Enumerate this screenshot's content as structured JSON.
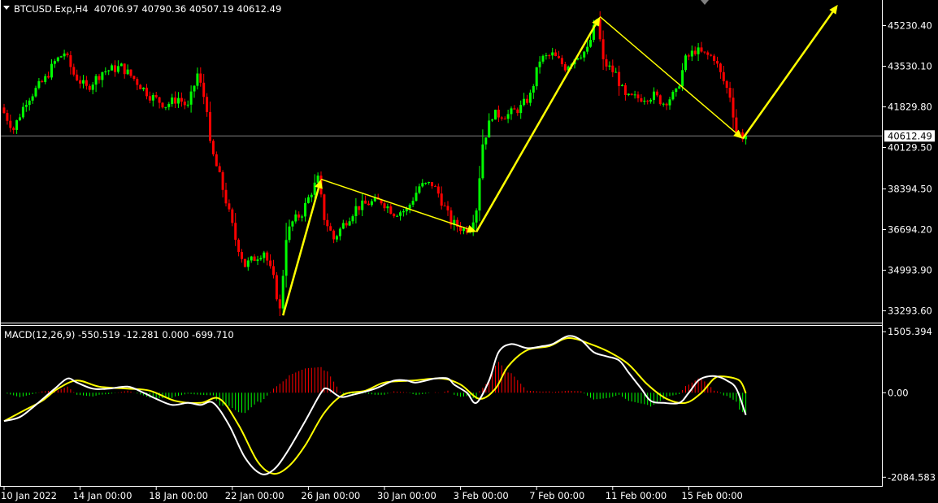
{
  "header": {
    "symbol_line": "BTCUSD.Exp,H4  40706.97 40790.36 40507.19 40612.49"
  },
  "macd_header": "MACD(12,26,9) -550.519 -12.281 0.000 -699.710",
  "colors": {
    "background": "#000000",
    "bull": "#00ff00",
    "bear": "#ff0000",
    "arrow": "#ffff00",
    "macd_line": "#ffffff",
    "signal_line": "#ffff00",
    "hist_pos": "#ff0000",
    "hist_neg": "#00ff00",
    "frame": "#ffffff",
    "price_line": "#808080"
  },
  "chart_data": [
    {
      "type": "candlestick",
      "title": "BTCUSD.Exp,H4",
      "timeframe": "H4",
      "last_ohlc": {
        "open": 40706.97,
        "high": 40790.36,
        "low": 40507.19,
        "close": 40612.49
      },
      "current_price_label": "40612.49",
      "current_price": 40612.49,
      "y_ticks": [
        "45230.40",
        "43530.10",
        "41829.80",
        "40129.50",
        "38394.50",
        "36694.20",
        "34993.90",
        "33293.60"
      ],
      "y_tick_values": [
        45230.4,
        43530.1,
        41829.8,
        40129.5,
        38394.5,
        36694.2,
        34993.9,
        33293.6
      ],
      "x_ticks": [
        "10 Jan 2022",
        "14 Jan 00:00",
        "18 Jan 00:00",
        "22 Jan 00:00",
        "26 Jan 00:00",
        "30 Jan 00:00",
        "3 Feb 00:00",
        "7 Feb 00:00",
        "11 Feb 00:00",
        "15 Feb 00:00"
      ],
      "x_start": "2022-01-10 00:00",
      "ylim": [
        32800,
        46300
      ],
      "price_path": [
        [
          "2022-01-10 00:00",
          41800
        ],
        [
          "2022-01-10 16:00",
          40900
        ],
        [
          "2022-01-11 08:00",
          42100
        ],
        [
          "2022-01-12 08:00",
          43000
        ],
        [
          "2022-01-12 20:00",
          43700
        ],
        [
          "2022-01-13 08:00",
          44100
        ],
        [
          "2022-01-13 20:00",
          43200
        ],
        [
          "2022-01-14 12:00",
          42600
        ],
        [
          "2022-01-15 08:00",
          43300
        ],
        [
          "2022-01-16 08:00",
          43500
        ],
        [
          "2022-01-17 00:00",
          43000
        ],
        [
          "2022-01-17 20:00",
          42300
        ],
        [
          "2022-01-18 16:00",
          41900
        ],
        [
          "2022-01-19 08:00",
          42200
        ],
        [
          "2022-01-19 20:00",
          41800
        ],
        [
          "2022-01-20 08:00",
          43200
        ],
        [
          "2022-01-20 20:00",
          41800
        ],
        [
          "2022-01-21 00:00",
          40200
        ],
        [
          "2022-01-21 12:00",
          38900
        ],
        [
          "2022-01-21 20:00",
          37900
        ],
        [
          "2022-01-22 08:00",
          36300
        ],
        [
          "2022-01-22 20:00",
          35200
        ],
        [
          "2022-01-23 08:00",
          35500
        ],
        [
          "2022-01-23 20:00",
          35800
        ],
        [
          "2022-01-24 08:00",
          34600
        ],
        [
          "2022-01-24 16:00",
          33300
        ],
        [
          "2022-01-25 00:00",
          36400
        ],
        [
          "2022-01-25 08:00",
          37000
        ],
        [
          "2022-01-25 20:00",
          37400
        ],
        [
          "2022-01-26 08:00",
          38300
        ],
        [
          "2022-01-26 16:00",
          38800
        ],
        [
          "2022-01-27 00:00",
          37200
        ],
        [
          "2022-01-27 12:00",
          36300
        ],
        [
          "2022-01-28 00:00",
          36900
        ],
        [
          "2022-01-28 16:00",
          37600
        ],
        [
          "2022-01-29 08:00",
          37800
        ],
        [
          "2022-01-30 00:00",
          37900
        ],
        [
          "2022-01-30 16:00",
          37400
        ],
        [
          "2022-01-31 08:00",
          37500
        ],
        [
          "2022-02-01 00:00",
          38500
        ],
        [
          "2022-02-01 16:00",
          38600
        ],
        [
          "2022-02-02 00:00",
          38200
        ],
        [
          "2022-02-02 16:00",
          37000
        ],
        [
          "2022-02-03 08:00",
          36700
        ],
        [
          "2022-02-03 16:00",
          36800
        ],
        [
          "2022-02-04 00:00",
          37600
        ],
        [
          "2022-02-04 08:00",
          40300
        ],
        [
          "2022-02-04 20:00",
          41500
        ],
        [
          "2022-02-05 16:00",
          41500
        ],
        [
          "2022-02-06 08:00",
          41800
        ],
        [
          "2022-02-06 20:00",
          42300
        ],
        [
          "2022-02-07 08:00",
          43800
        ],
        [
          "2022-02-08 00:00",
          44000
        ],
        [
          "2022-02-08 16:00",
          43500
        ],
        [
          "2022-02-09 08:00",
          44000
        ],
        [
          "2022-02-09 20:00",
          44200
        ],
        [
          "2022-02-10 08:00",
          45500
        ],
        [
          "2022-02-10 16:00",
          43700
        ],
        [
          "2022-02-11 08:00",
          43200
        ],
        [
          "2022-02-11 20:00",
          42200
        ],
        [
          "2022-02-12 12:00",
          42200
        ],
        [
          "2022-02-13 08:00",
          42300
        ],
        [
          "2022-02-13 20:00",
          42000
        ],
        [
          "2022-02-14 12:00",
          42400
        ],
        [
          "2022-02-15 00:00",
          43800
        ],
        [
          "2022-02-15 12:00",
          44200
        ],
        [
          "2022-02-16 00:00",
          44000
        ],
        [
          "2022-02-16 12:00",
          43900
        ],
        [
          "2022-02-16 20:00",
          43200
        ],
        [
          "2022-02-17 08:00",
          42300
        ],
        [
          "2022-02-17 16:00",
          40800
        ],
        [
          "2022-02-18 00:00",
          40612.49
        ]
      ],
      "annotations": {
        "arrows": [
          {
            "from": [
              "2022-01-24 16:00",
              33100
            ],
            "to": [
              "2022-01-26 16:00",
              38800
            ]
          },
          {
            "from": [
              "2022-01-26 16:00",
              38800
            ],
            "to": [
              "2022-02-03 20:00",
              36600
            ]
          },
          {
            "from": [
              "2022-02-03 20:00",
              36600
            ],
            "to": [
              "2022-02-10 08:00",
              45600
            ]
          },
          {
            "from": [
              "2022-02-10 08:00",
              45600
            ],
            "to": [
              "2022-02-17 20:00",
              40500
            ]
          },
          {
            "from": [
              "2022-02-17 20:00",
              40500
            ],
            "to": [
              "2022-02-22 20:00",
              46100
            ]
          }
        ]
      }
    },
    {
      "type": "line",
      "title": "MACD(12,26,9) -550.519 -12.281 0.000 -699.710",
      "y_ticks": [
        "1505.394",
        "0.00",
        "-2084.583"
      ],
      "y_tick_values": [
        1505.394,
        0,
        -2084.583
      ],
      "ylim": [
        -2300,
        1650
      ],
      "series": [
        {
          "name": "MACD",
          "points": [
            [
              "2022-01-10 00:00",
              -700
            ],
            [
              "2022-01-10 20:00",
              -600
            ],
            [
              "2022-01-11 16:00",
              -300
            ],
            [
              "2022-01-12 16:00",
              100
            ],
            [
              "2022-01-13 08:00",
              350
            ],
            [
              "2022-01-13 20:00",
              250
            ],
            [
              "2022-01-14 16:00",
              100
            ],
            [
              "2022-01-15 12:00",
              100
            ],
            [
              "2022-01-16 12:00",
              150
            ],
            [
              "2022-01-17 08:00",
              0
            ],
            [
              "2022-01-18 00:00",
              -150
            ],
            [
              "2022-01-18 20:00",
              -300
            ],
            [
              "2022-01-19 16:00",
              -250
            ],
            [
              "2022-01-20 08:00",
              -300
            ],
            [
              "2022-01-21 00:00",
              -250
            ],
            [
              "2022-01-21 20:00",
              -800
            ],
            [
              "2022-01-22 16:00",
              -1600
            ],
            [
              "2022-01-23 12:00",
              -2000
            ],
            [
              "2022-01-24 04:00",
              -1900
            ],
            [
              "2022-01-24 20:00",
              -1500
            ],
            [
              "2022-01-25 20:00",
              -700
            ],
            [
              "2022-01-26 16:00",
              0
            ],
            [
              "2022-01-27 00:00",
              100
            ],
            [
              "2022-01-27 16:00",
              -100
            ],
            [
              "2022-01-28 08:00",
              -50
            ],
            [
              "2022-01-29 12:00",
              100
            ],
            [
              "2022-01-30 12:00",
              300
            ],
            [
              "2022-01-31 04:00",
              300
            ],
            [
              "2022-01-31 16:00",
              250
            ],
            [
              "2022-02-01 16:00",
              350
            ],
            [
              "2022-02-02 08:00",
              350
            ],
            [
              "2022-02-02 16:00",
              200
            ],
            [
              "2022-02-03 08:00",
              0
            ],
            [
              "2022-02-03 20:00",
              -250
            ],
            [
              "2022-02-04 12:00",
              300
            ],
            [
              "2022-02-05 00:00",
              1000
            ],
            [
              "2022-02-05 16:00",
              1200
            ],
            [
              "2022-02-06 12:00",
              1100
            ],
            [
              "2022-02-07 08:00",
              1150
            ],
            [
              "2022-02-07 20:00",
              1200
            ],
            [
              "2022-02-08 16:00",
              1400
            ],
            [
              "2022-02-09 08:00",
              1300
            ],
            [
              "2022-02-10 00:00",
              1000
            ],
            [
              "2022-02-10 16:00",
              900
            ],
            [
              "2022-02-11 08:00",
              800
            ],
            [
              "2022-02-11 20:00",
              500
            ],
            [
              "2022-02-12 12:00",
              100
            ],
            [
              "2022-02-13 00:00",
              -200
            ],
            [
              "2022-02-13 16:00",
              -250
            ],
            [
              "2022-02-14 12:00",
              -250
            ],
            [
              "2022-02-15 00:00",
              0
            ],
            [
              "2022-02-15 12:00",
              300
            ],
            [
              "2022-02-16 00:00",
              400
            ],
            [
              "2022-02-16 12:00",
              400
            ],
            [
              "2022-02-17 00:00",
              300
            ],
            [
              "2022-02-17 12:00",
              100
            ],
            [
              "2022-02-18 00:00",
              -550.519
            ]
          ]
        },
        {
          "name": "Signal",
          "points": [
            [
              "2022-01-10 00:00",
              -700
            ],
            [
              "2022-01-11 00:00",
              -450
            ],
            [
              "2022-01-12 00:00",
              -200
            ],
            [
              "2022-01-12 20:00",
              100
            ],
            [
              "2022-01-13 20:00",
              300
            ],
            [
              "2022-01-15 00:00",
              150
            ],
            [
              "2022-01-16 12:00",
              100
            ],
            [
              "2022-01-17 16:00",
              50
            ],
            [
              "2022-01-19 00:00",
              -200
            ],
            [
              "2022-01-20 08:00",
              -250
            ],
            [
              "2022-01-21 08:00",
              -150
            ],
            [
              "2022-01-22 08:00",
              -800
            ],
            [
              "2022-01-23 08:00",
              -1700
            ],
            [
              "2022-01-24 04:00",
              -2000
            ],
            [
              "2022-01-25 00:00",
              -1800
            ],
            [
              "2022-01-25 20:00",
              -1300
            ],
            [
              "2022-01-26 20:00",
              -500
            ],
            [
              "2022-01-27 20:00",
              -50
            ],
            [
              "2022-01-29 00:00",
              50
            ],
            [
              "2022-01-30 00:00",
              250
            ],
            [
              "2022-01-31 12:00",
              300
            ],
            [
              "2022-02-02 00:00",
              350
            ],
            [
              "2022-02-03 00:00",
              200
            ],
            [
              "2022-02-04 00:00",
              -150
            ],
            [
              "2022-02-04 20:00",
              100
            ],
            [
              "2022-02-05 12:00",
              650
            ],
            [
              "2022-02-06 12:00",
              1050
            ],
            [
              "2022-02-07 16:00",
              1150
            ],
            [
              "2022-02-08 16:00",
              1350
            ],
            [
              "2022-02-09 20:00",
              1200
            ],
            [
              "2022-02-10 20:00",
              1000
            ],
            [
              "2022-02-11 20:00",
              700
            ],
            [
              "2022-02-12 20:00",
              200
            ],
            [
              "2022-02-13 20:00",
              -150
            ],
            [
              "2022-02-14 20:00",
              -250
            ],
            [
              "2022-02-15 16:00",
              0
            ],
            [
              "2022-02-16 08:00",
              350
            ],
            [
              "2022-02-16 20:00",
              400
            ],
            [
              "2022-02-17 16:00",
              300
            ],
            [
              "2022-02-18 00:00",
              -12.281
            ]
          ]
        }
      ]
    }
  ]
}
